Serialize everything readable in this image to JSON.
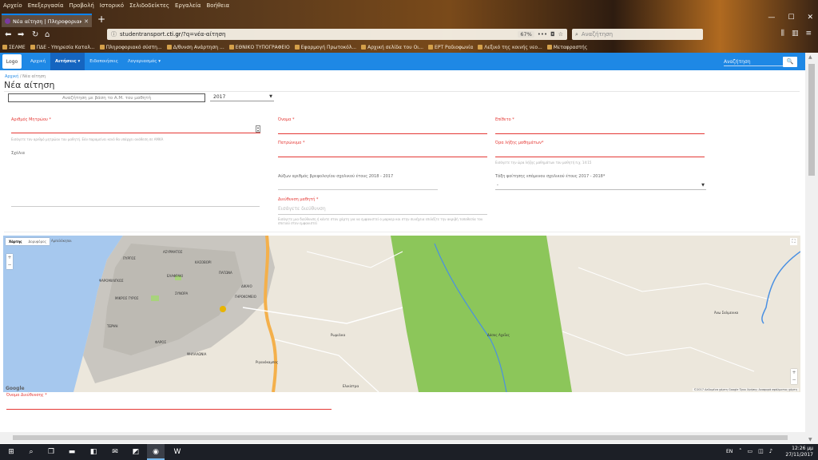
{
  "browser": {
    "menu": [
      "Αρχείο",
      "Επεξεργασία",
      "Προβολή",
      "Ιστορικό",
      "Σελιδοδείκτες",
      "Εργαλεία",
      "Βοήθεια"
    ],
    "tab_title": "Νέα αίτηση | Πληροφοριακό...",
    "url_prefix": "studentransport.",
    "url_domain": "cti.gr",
    "url_path": "/?q=νέα-αίτηση",
    "zoom": "67%",
    "web_search_placeholder": "Αναζήτηση",
    "bookmarks": [
      "ΣΕΛΜΕ",
      "ΠΔΕ - Υπηρεσία Καταλ...",
      "Πληροφοριακό σύστη...",
      "Δ/θυνση Ανάρτηση ...",
      "ΕΘΝΙΚΟ ΤΥΠΟΓΡΑΦΕΙΟ",
      "Εφαρμογή Πρωτοκόλ...",
      "Αρχική σελίδα του Οι...",
      "ΕΡΤ Ραδιοφωνία",
      "Λεξικό της κοινής νεο...",
      "Μεταφραστής"
    ]
  },
  "site": {
    "logo_text": "Logo",
    "nav": [
      "Αρχική",
      "Αιτήσεις ▾",
      "Ειδοποιήσεις",
      "Λογαριασμός ▾"
    ],
    "search_placeholder": "Αναζήτηση",
    "search_button": "🔍"
  },
  "page": {
    "breadcrumb_home": "Αρχική",
    "breadcrumb_current": "Νέα αίτηση",
    "title": "Νέα αίτηση",
    "student_search_placeholder": "Αναζήτηση με βάση το Α.Μ. του μαθητή",
    "year": "2017"
  },
  "form": {
    "am_label": "Αριθμός Μητρώου *",
    "am_hint": "Εισάγετε τον αριθμό μητρώου του μαθητή. Εάν παραμείνει κενό θα υπάρχει ανάθεση σε ΑΜΚΑ",
    "name_label": "Όνομα *",
    "surname_label": "Επίθετο *",
    "father_label": "Πατρώνυμο *",
    "code_label": "Όρα λήξης μαθημάτων*",
    "code_hint": "Εισάγετε την ώρα λήξης μαθημάτων του μαθητή π.χ. 14:15",
    "notes_label": "Σχόλια",
    "reg_label": "Αύξων αριθμός βρεφολογίου σχολικού έτους 2018 - 2017",
    "class_label": "Τάξη φοίτησης επόμενου σχολικού έτους 2017 - 2018*",
    "class_value": "-",
    "address_label": "Διεύθυνση μαθητή *",
    "address_placeholder": "Εισάγετε διεύθυνση",
    "address_hint": "Εισάγετε μια διεύθυνση ή κάντε στον χάρτη για να εμφανιστεί ο μαρκερ και στην συνέχεια επιλέξτε την ακριβή τοποθεσία του σπιτιού στον",
    "address_hint2": "εμφανιστεί",
    "map_address_label": "Όνομα Διεύθυνσης *"
  },
  "map": {
    "type_map": "Χάρτης",
    "type_sat": "Δορυφόρος",
    "labels": [
      "Αμπελόκηποι",
      "ΑΣΥΡΜΑΤΟΣ",
      "ΠΥΡΓΟΣ",
      "ΚΑΣΟΒΟΡΙ",
      "ΕΛΑΦΡΑΚΙ",
      "ΠΑΓΩΝΑ",
      "ΔΙΚΑΙΟ",
      "ΓΗΡΟΚΟΜΕΙΟ",
      "ΣΥΝΟΡΑ",
      "ΨΑΡΟΜΙΛΙΓΚΟΣ",
      "ΜΙΚΡΟΣ ΓΥΡΟΣ",
      "ΤΕΡΨΗ",
      "ΦΑΡΟΣ",
      "ΨΗΛΑΛΩΝΙΑ",
      "Ριγανόκαμπος",
      "Ρωμιέικα",
      "Δάσος Αχαΐας",
      "Ελικίστρα",
      "Άνω Σαλμενικο"
    ],
    "google": "Google",
    "terms": "©2017 Δεδομένα χάρτη Google   Όροι Χρήσης   Αναφορά σφάλματος χάρτη"
  },
  "taskbar": {
    "lang": "EN",
    "time": "12:26 μμ",
    "date": "27/11/2017"
  },
  "colors": {
    "primary": "#1e88e5",
    "required": "#e53935"
  }
}
